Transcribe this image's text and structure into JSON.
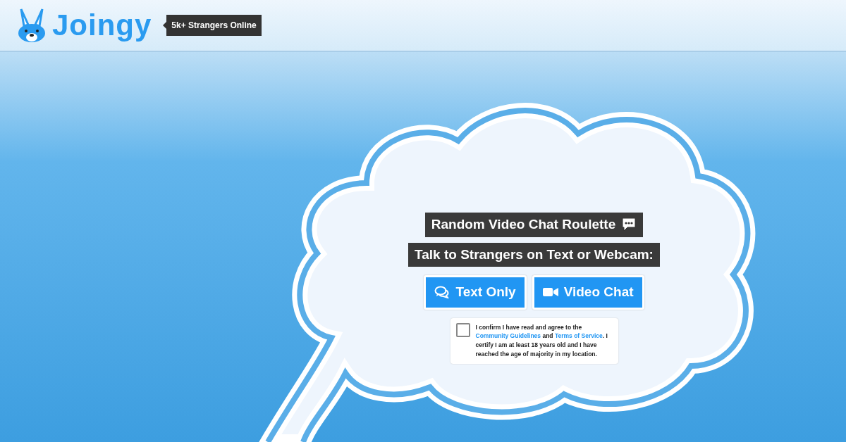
{
  "header": {
    "logo_text": "Joingy",
    "online_badge": "5k+ Strangers Online"
  },
  "hero": {
    "title": "Random Video Chat Roulette",
    "subtitle": "Talk to Strangers on Text or Webcam:"
  },
  "buttons": [
    {
      "kind": "text",
      "label": "Text Only"
    },
    {
      "kind": "video",
      "label": "Video Chat"
    }
  ],
  "consent": {
    "checked": false,
    "parts": [
      {
        "kind": "text",
        "text": "I confirm I have read and agree to the "
      },
      {
        "kind": "link",
        "text": "Community Guidelines"
      },
      {
        "kind": "text",
        "text": " and "
      },
      {
        "kind": "link",
        "text": "Terms of Service"
      },
      {
        "kind": "text",
        "text": ". I certify I am at least 18 years old and I have reached the age of majority in my location."
      }
    ]
  }
}
